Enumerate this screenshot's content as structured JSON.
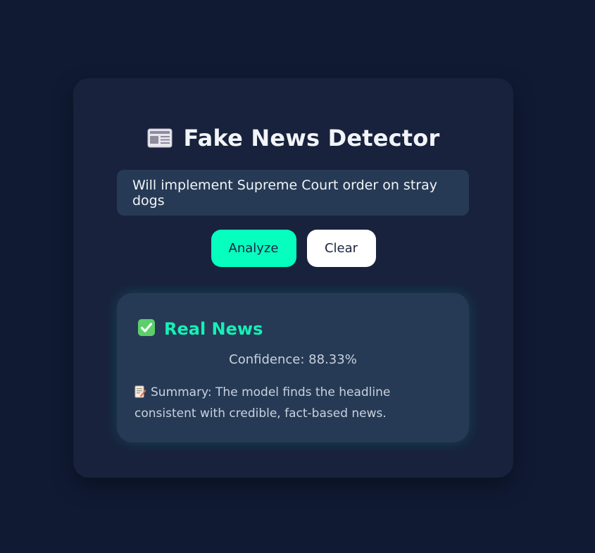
{
  "app": {
    "title": "Fake News Detector",
    "title_icon": "newspaper-icon"
  },
  "input": {
    "value": "Will implement Supreme Court order on stray dogs"
  },
  "buttons": {
    "analyze_label": "Analyze",
    "clear_label": "Clear"
  },
  "result": {
    "verdict_icon": "check-mark-icon",
    "verdict": "Real News",
    "confidence": "Confidence: 88.33%",
    "summary_icon": "memo-icon",
    "summary": "Summary: The model finds the headline consistent with credible, fact-based news."
  },
  "colors": {
    "background": "#101a33",
    "card": "#18223d",
    "panel": "#263a55",
    "accent": "#06ffbf",
    "verdict": "#15f0b6"
  }
}
